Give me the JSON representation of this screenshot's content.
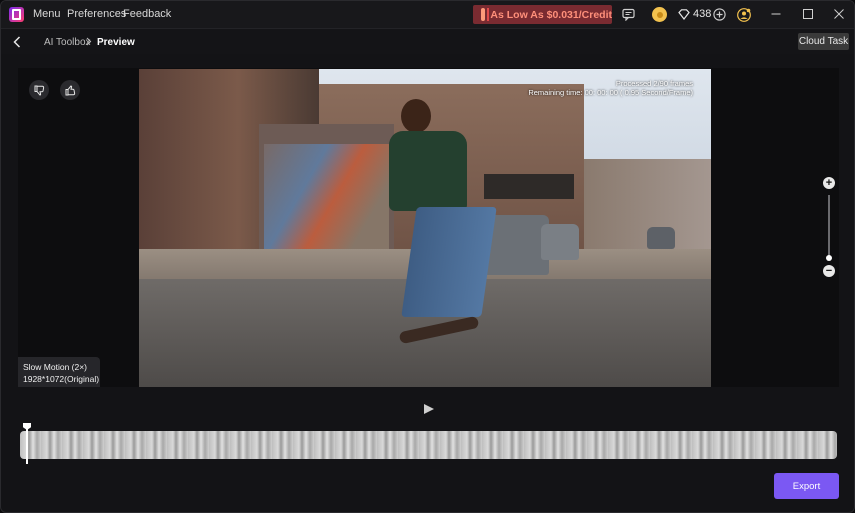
{
  "titlebar": {
    "menu": [
      "Menu",
      "Preferences",
      "Feedback"
    ],
    "promo": "As Low As $0.031/Credit",
    "credits": "438",
    "icons": [
      "app-logo-icon",
      "gift-icon",
      "message-icon",
      "coin-icon",
      "diamond-icon",
      "plus-icon",
      "avatar-icon",
      "minimize-icon",
      "maximize-icon",
      "close-icon"
    ]
  },
  "navbar": {
    "breadcrumb_parent": "AI Toolbox",
    "breadcrumb_current": "Preview",
    "cloud_task": "Cloud Task"
  },
  "preview": {
    "overlay_line1": "Processed 2/90 frames",
    "overlay_line2": "Remaining time: 00: 00: 00 ( 0.95 Second/Frame)",
    "info_line1": "Slow Motion (2×)",
    "info_line2": "1928*1072(Original)",
    "thumbs_down_label": "dislike",
    "thumbs_up_label": "like"
  },
  "zoom": {
    "plus": "+",
    "minus": "−"
  },
  "actions": {
    "export": "Export"
  },
  "colors": {
    "accent": "#7b58f3",
    "promo_bg": "#7a2b31",
    "promo_text": "#ff8f7a"
  }
}
